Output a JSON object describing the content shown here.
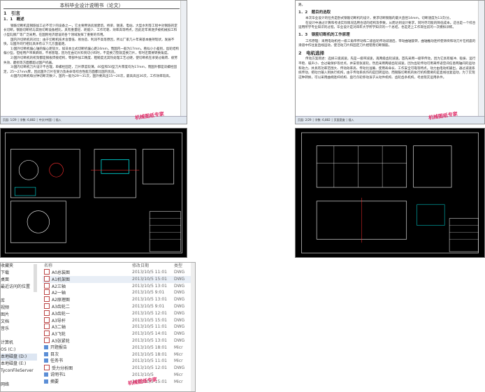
{
  "doc_left": {
    "header": "本科毕业设计说明书（论文）",
    "h1": "1　引言",
    "h2": "1．1　概述",
    "paragraphs": [
      "钢筋切断机是钢筋加工必不可少的设备之一，它主要用语房屋建筑、桥梁、隧道、电站、大型水利等工程中对钢筋的定长切断。钢筋切断机与其他切断设备相比，具有重量轻、耗能少、工作可靠、效率高等特点，因此近年来逐步被机械加工和小型轧钢厂等广泛采用，在国民经济建设的各个领域发挥了重要的作用。",
      "国内外切断机的对比：由于切断机技术含量低、易仿造、利润不高等原因，所以厂家几十年来基本维持现状，发展不快，与国外同行相比具体有以下几方面差距。",
      "1)国外切断机偏心轴的偏心距较大，如日本立式切断机偏心距24mm，而国内一般为17mm。看似小小差别，齿轮结构偏小些，但给用户带来麻烦，不易管理，因为在由切大料到切小料时，不是换刀垫就是换刀片，有时还需要转换角度。",
      "2)国外切断机的机架都是钢板焊接结构，零部件加工精度、粗糙度尤其热处理工艺过硬，使切断机在承受过载荷、疲劳失效、磨损等方面都超过国产机器。",
      "3)国内切断机刀片设计不合理，单螺栓固定，刀片厚度较薄，40型和50型刀片厚度均为17mm，而国外都是双螺栓固定，25～27mm厚，因此国外刀片在受力及寿命等综合性能方面都比国内优良。",
      "4)国内切断机每分钟切断次数少，国内一般为29～31次，国外要高出15～20次，最高高出30次，工作效率较高。"
    ],
    "status": "页面: 1/29 │ 字数: 6,882 │ 中文(中国) │ 插入"
  },
  "doc_right": {
    "lead": "路。",
    "sections": [
      {
        "title": "1．2　题目的选取",
        "paragraphs": [
          "本次毕业设计的任务是卧式钢筋切断机的设计，要求切断钢筋的最大直径14mm，切断速度为13次/分。",
          "在设计中通过计算和考虑实际情况选用合适的结构及参数，从而达到设计要求，同时尽可能的降低成本。这也是一个综合运用所学专业知识的过程，毕业设计是对四年大学所学知识的一个总结，也是走上工作岗位前的一次模拟训练。"
        ]
      },
      {
        "title": "1．3　钢筋切断机的工作原理",
        "paragraphs": [
          "工作原理：采用电动机经一级三角带传动和二级齿轮传动减速后，带动曲轴旋转，曲轴推动连杆使滑块和动刀片在机座的滑道中作往复直线运动，使活动刀片和固定刀片相错而切断钢筋。"
        ]
      },
      {
        "title": "2　电机选择",
        "paragraphs": [
          "传动方案简述：选择三级减速，先是一级带减速，再两级齿轮减速。首先采用一级带传动，因为它具有缓冲、吸振、运行平稳、噪声小、合过载保护等优点，并安装张紧轮。然后采用两级齿轮减速，因为齿轮传动可用来传递空间任意两轴间的运动和动力，并具有功率范围大、传动效率高、传动比准确、使用寿命长、工作安全可靠等特点。动力由电动机输出，通过减速系统传动，把动力输入到执行机构，由于传动系统作的是回转运动，而钢筋切断机的执行机构需要的是直线往复运动，为了实现这种转换，可以采用曲柄连杆机构、盘行凸轮移动滚子从动件机构、齿轮齿条机构，考虑现实运用条件。"
        ]
      }
    ],
    "status": "页面: 2/29 │ 字数: 6,882 │ 页面宽度 │ 插入"
  },
  "watermark": "机械图纸专家",
  "explorer": {
    "nav": [
      "收藏夹",
      "下载",
      "桌面",
      "最近访问的位置",
      "",
      "库",
      "视频",
      "图片",
      "文档",
      "音乐",
      "",
      "计算机",
      "OS (C:)",
      "本地磁盘 (D:)",
      "本地磁盘 (E:)",
      "TyconFileServer",
      "",
      "网络"
    ],
    "columns": [
      "名称",
      "修改日期",
      "类型"
    ],
    "files": [
      {
        "name": "A0总装图",
        "date": "2013/10/5 11:01",
        "type": "DWG",
        "kind": "dwg"
      },
      {
        "name": "A1机架图",
        "date": "2013/10/5 15:01",
        "type": "DWG",
        "kind": "dwg",
        "selected": true
      },
      {
        "name": "A2三轴",
        "date": "2013/10/5 13:01",
        "type": "DWG",
        "kind": "dwg"
      },
      {
        "name": "A2一轴",
        "date": "2013/10/5 9:01",
        "type": "DWG",
        "kind": "dwg"
      },
      {
        "name": "A2原理图",
        "date": "2013/10/5 13:01",
        "type": "DWG",
        "kind": "dwg"
      },
      {
        "name": "A3齿轮二",
        "date": "2013/10/5 9:01",
        "type": "DWG",
        "kind": "dwg"
      },
      {
        "name": "A3齿轮一",
        "date": "2013/10/5 12:01",
        "type": "DWG",
        "kind": "dwg"
      },
      {
        "name": "A3导杆",
        "date": "2013/10/5 15:01",
        "type": "DWG",
        "kind": "dwg"
      },
      {
        "name": "A3二轴",
        "date": "2013/10/5 11:01",
        "type": "DWG",
        "kind": "dwg"
      },
      {
        "name": "A3飞轮",
        "date": "2013/10/5 14:01",
        "type": "DWG",
        "kind": "dwg"
      },
      {
        "name": "A3张紧轮",
        "date": "2013/10/5 13:01",
        "type": "DWG",
        "kind": "dwg"
      },
      {
        "name": "开题报告",
        "date": "2013/10/5 18:01",
        "type": "Micr",
        "kind": "doc"
      },
      {
        "name": "目次",
        "date": "2013/10/5 18:01",
        "type": "Micr",
        "kind": "doc"
      },
      {
        "name": "任务书",
        "date": "2013/10/5 11:01",
        "type": "Micr",
        "kind": "doc"
      },
      {
        "name": "受力分析图",
        "date": "2013/10/5 12:01",
        "type": "DWG",
        "kind": "dwg"
      },
      {
        "name": "说明书1",
        "date": "2013/10/5",
        "type": "Micr",
        "kind": "doc"
      },
      {
        "name": "摘要",
        "date": "2013/10/5 15:01",
        "type": "Micr",
        "kind": "doc"
      }
    ]
  },
  "colors": {
    "cad_bg": "#000000",
    "cad_line": "#ffffff",
    "cad_red": "#ff3030",
    "cad_cyan": "#00e5e5",
    "watermark": "#e0306a",
    "selection": "#e8eef6"
  }
}
